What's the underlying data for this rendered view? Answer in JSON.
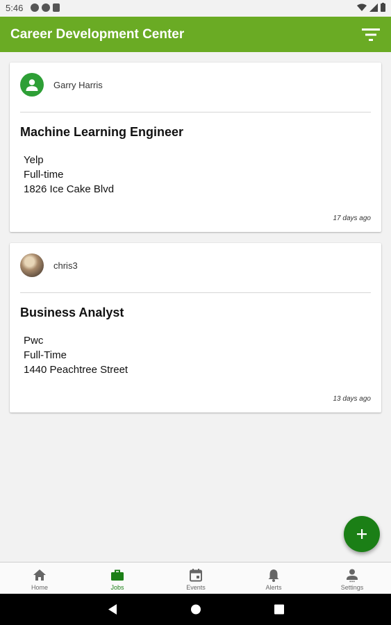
{
  "status_bar": {
    "time": "5:46"
  },
  "app_bar": {
    "title": "Career Development Center"
  },
  "posts": [
    {
      "user": "Garry Harris",
      "job_title": "Machine Learning Engineer",
      "company": "Yelp",
      "type": "Full-time",
      "address": "1826 Ice Cake Blvd",
      "posted": "17 days ago",
      "avatar": "default-user-icon"
    },
    {
      "user": "chris3",
      "job_title": "Business Analyst",
      "company": "Pwc",
      "type": "Full-Time",
      "address": "1440 Peachtree Street",
      "posted": "13 days ago",
      "avatar": "user-photo"
    }
  ],
  "fab": {
    "icon": "plus-icon"
  },
  "bottom_nav": {
    "items": [
      {
        "label": "Home",
        "icon": "home-icon"
      },
      {
        "label": "Jobs",
        "icon": "briefcase-icon",
        "active": true
      },
      {
        "label": "Events",
        "icon": "calendar-icon"
      },
      {
        "label": "Alerts",
        "icon": "bell-icon"
      },
      {
        "label": "Settings",
        "icon": "person-icon"
      }
    ]
  },
  "colors": {
    "app_bar": "#6aab24",
    "accent": "#1b7f16",
    "avatar_green": "#2e9f36"
  }
}
